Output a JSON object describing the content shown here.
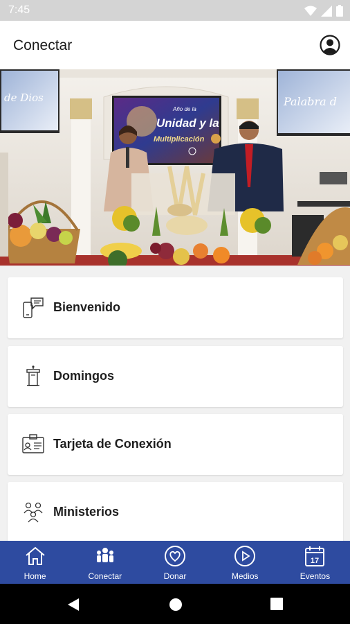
{
  "status_bar": {
    "time": "7:45",
    "icons": [
      "wifi-icon",
      "signal-icon",
      "battery-icon"
    ]
  },
  "app_bar": {
    "title": "Conectar",
    "profile_icon": "account-circle-icon"
  },
  "hero": {
    "left_screen_text": "de Dios",
    "right_screen_text": "Palabra d",
    "center_screen_line1": "Año de la",
    "center_screen_line2": "Unidad y la",
    "center_screen_line3": "Multiplicación"
  },
  "list": {
    "items": [
      {
        "label": "Bienvenido",
        "icon": "chat-phone-icon"
      },
      {
        "label": "Domingos",
        "icon": "pulpit-icon"
      },
      {
        "label": "Tarjeta de Conexión",
        "icon": "id-card-icon"
      },
      {
        "label": "Ministerios",
        "icon": "people-group-icon"
      }
    ]
  },
  "bottom_nav": {
    "items": [
      {
        "label": "Home",
        "icon": "home-icon"
      },
      {
        "label": "Conectar",
        "icon": "people-icon"
      },
      {
        "label": "Donar",
        "icon": "heart-circle-icon"
      },
      {
        "label": "Medios",
        "icon": "play-circle-icon"
      },
      {
        "label": "Eventos",
        "icon": "calendar-icon",
        "day": "17"
      }
    ]
  },
  "colors": {
    "nav_background": "#2e4ba0",
    "status_bar": "#d4d4d4",
    "list_background": "#f1f1f1"
  }
}
